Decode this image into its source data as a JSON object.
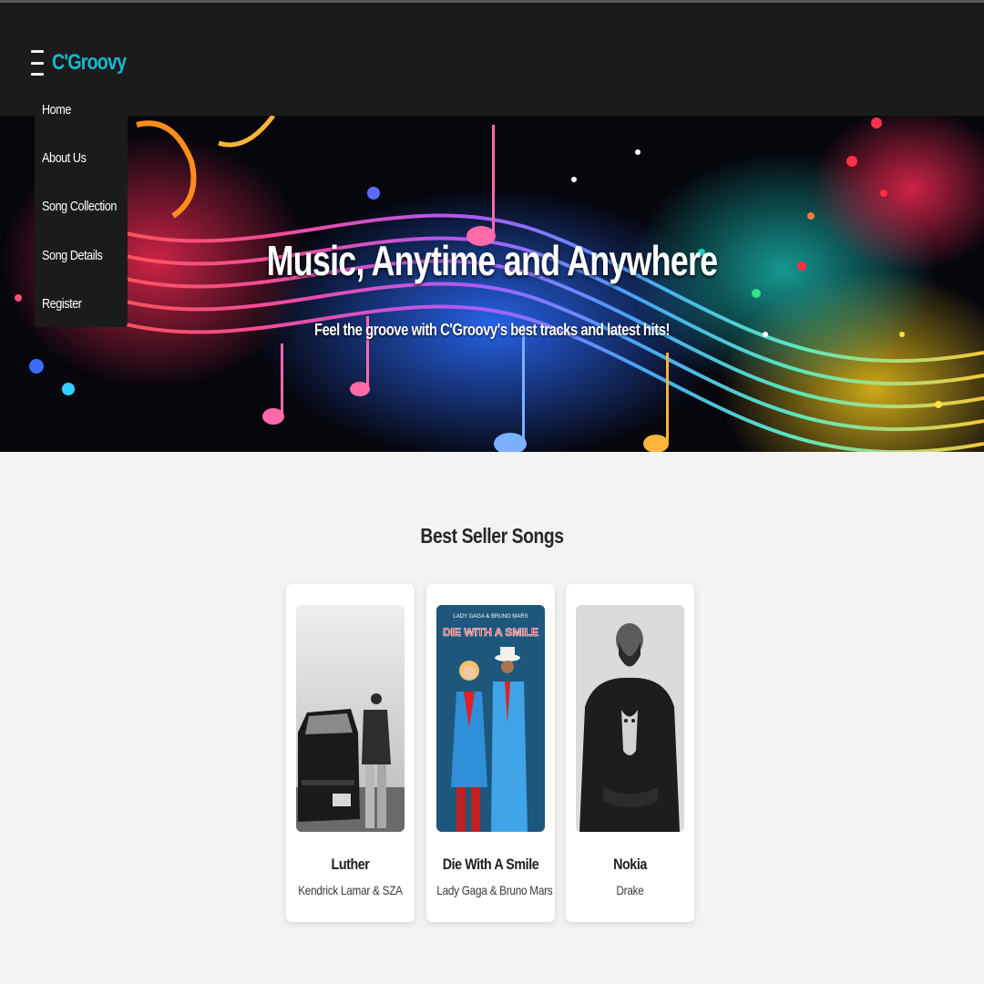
{
  "brand": {
    "name": "C'Groovy",
    "color": "#17b8d0"
  },
  "nav": {
    "icon": "hamburger-menu-icon",
    "items": [
      {
        "label": "Home"
      },
      {
        "label": "About Us"
      },
      {
        "label": "Song Collection"
      },
      {
        "label": "Song Details"
      },
      {
        "label": "Register"
      }
    ]
  },
  "hero": {
    "title": "Music, Anytime and Anywhere",
    "subtitle": "Feel the groove with C'Groovy's best tracks and latest hits!"
  },
  "best_sellers": {
    "heading": "Best Seller Songs",
    "songs": [
      {
        "title": "Luther",
        "artist": "Kendrick Lamar & SZA"
      },
      {
        "title": "Die With A Smile",
        "artist": "Lady Gaga & Bruno Mars",
        "cover_text_top": "LADY GAGA & BRUNO MARS",
        "cover_text_main": "DIE WITH A SMILE"
      },
      {
        "title": "Nokia",
        "artist": "Drake"
      }
    ]
  },
  "colors": {
    "navbar": "#1b1b1b",
    "page_background": "#f3f3f3",
    "card_background": "#ffffff"
  }
}
